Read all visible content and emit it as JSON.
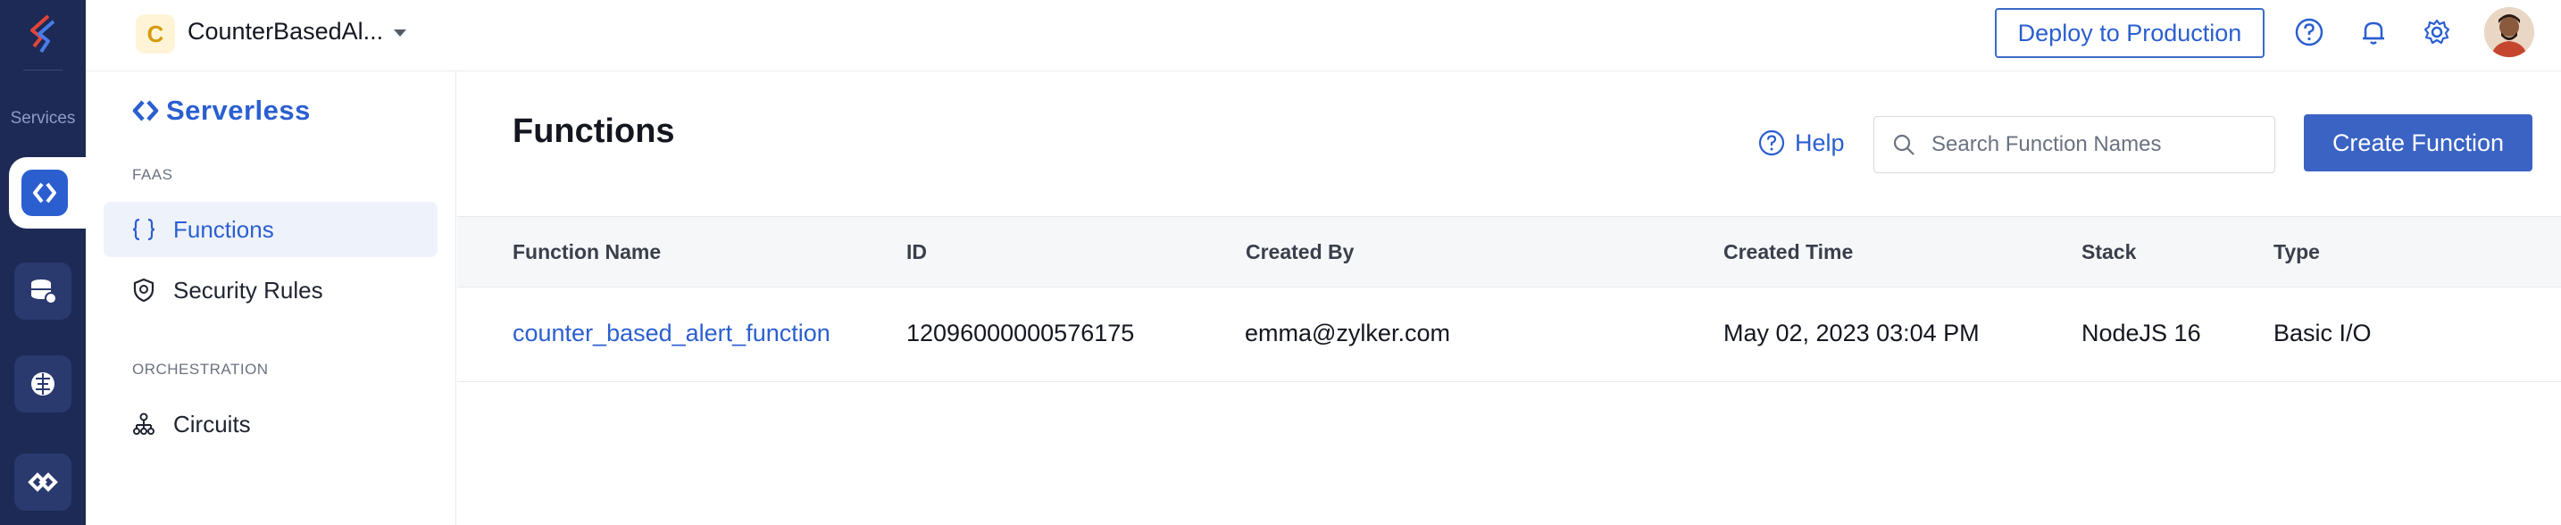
{
  "rail": {
    "label": "Services",
    "icons": [
      "catalyst-logo-icon",
      "serverless-icon",
      "cloud-scale-icon",
      "ai-brain-icon",
      "link-icon"
    ]
  },
  "topbar": {
    "project_initial": "C",
    "project_name": "CounterBasedAl...",
    "deploy_label": "Deploy to Production"
  },
  "sidebar": {
    "title": "Serverless",
    "sections": [
      {
        "label": "FAAS"
      },
      {
        "label": "ORCHESTRATION"
      }
    ],
    "items": [
      {
        "label": "Functions",
        "icon": "braces-icon",
        "active": true
      },
      {
        "label": "Security Rules",
        "icon": "shield-icon",
        "active": false
      },
      {
        "label": "Circuits",
        "icon": "hierarchy-icon",
        "active": false
      }
    ]
  },
  "main": {
    "title": "Functions",
    "help_label": "Help",
    "search_placeholder": "Search Function Names",
    "create_label": "Create Function",
    "table": {
      "columns": [
        "Function Name",
        "ID",
        "Created By",
        "Created Time",
        "Stack",
        "Type"
      ],
      "rows": [
        {
          "name": "counter_based_alert_function",
          "id": "12096000000576175",
          "created_by": "emma@zylker.com",
          "created_time": "May 02, 2023 03:04 PM",
          "stack": "NodeJS 16",
          "type": "Basic I/O"
        }
      ]
    }
  },
  "colors": {
    "rail_bg": "#1d2a55",
    "accent": "#2b5fd0",
    "primary_button": "#3a63c4",
    "project_badge": "#d89a0c"
  }
}
